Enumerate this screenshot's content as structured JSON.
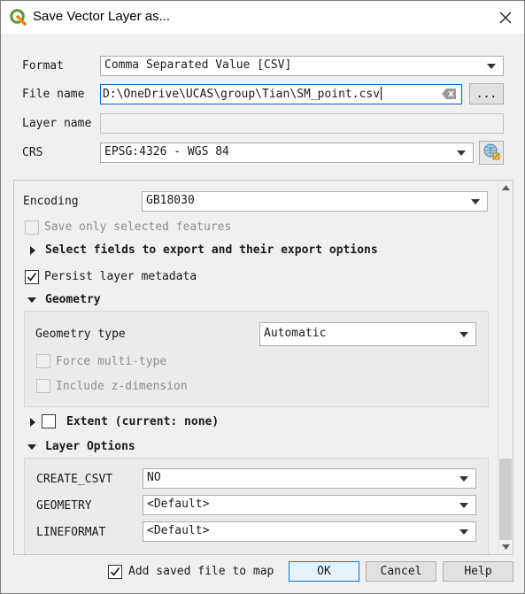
{
  "window": {
    "title": "Save Vector Layer as..."
  },
  "form": {
    "format_label": "Format",
    "format_value": "Comma Separated Value [CSV]",
    "filename_label": "File name",
    "filename_value": "D:\\OneDrive\\UCAS\\group\\Tian\\SM_point.csv",
    "browse_label": "...",
    "layername_label": "Layer name",
    "layername_value": "",
    "crs_label": "CRS",
    "crs_value": "EPSG:4326 - WGS 84"
  },
  "options": {
    "encoding_label": "Encoding",
    "encoding_value": "GB18030",
    "save_selected_label": "Save only selected features",
    "select_fields_label": "Select fields to export and their export options",
    "persist_metadata_label": "Persist layer metadata",
    "persist_metadata_checked": true,
    "geometry_section_label": "Geometry",
    "geometry_type_label": "Geometry type",
    "geometry_type_value": "Automatic",
    "force_multi_label": "Force multi-type",
    "include_z_label": "Include z-dimension",
    "extent_label": "Extent (current: none)",
    "layer_options_label": "Layer Options",
    "layer_options": [
      {
        "key": "CREATE_CSVT",
        "value": "NO"
      },
      {
        "key": "GEOMETRY",
        "value": "<Default>"
      },
      {
        "key": "LINEFORMAT",
        "value": "<Default>"
      }
    ]
  },
  "footer": {
    "add_to_map_label": "Add saved file to map",
    "add_to_map_checked": true,
    "ok_label": "OK",
    "cancel_label": "Cancel",
    "help_label": "Help"
  }
}
